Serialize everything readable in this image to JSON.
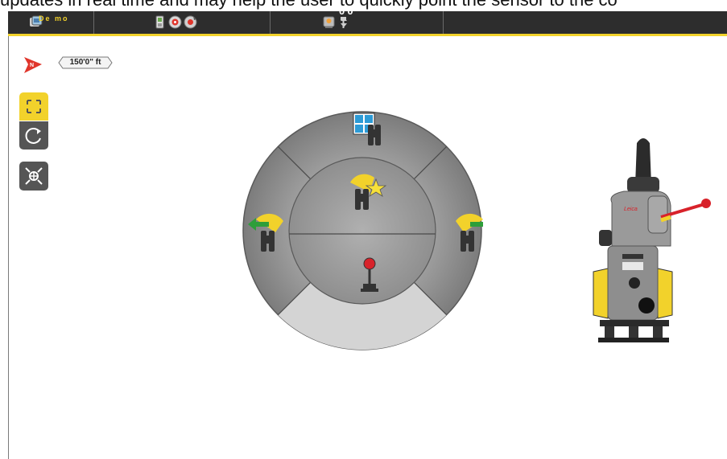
{
  "caption": "updates in real time and may help the user to quickly point the sensor to the co",
  "topbar": {
    "demo_label": "De mo",
    "angle_readout": "0'0\""
  },
  "scale": {
    "label": "150'0\" ft"
  },
  "colors": {
    "accent": "#f2d22b",
    "bar": "#2d2d2d",
    "wheel_outer": "#8c8c8c",
    "wheel_inner": "#9a9a9a",
    "wheel_highlight": "#d4d4d4",
    "north_arrow": "#e0352b",
    "arrow_green": "#2e9e3a",
    "joystick_red": "#d8222a"
  },
  "icons": {
    "topbar": [
      "demo-icon",
      "controller-icon",
      "target-icon",
      "settings-target-icon",
      "instrument-icon",
      "height-icon"
    ],
    "left": [
      "north-arrow-icon",
      "fit-to-screen-icon",
      "rotate-icon",
      "center-icon"
    ],
    "wheel": [
      "overview-camera-icon",
      "find-prism-icon",
      "turn-left-icon",
      "turn-right-icon",
      "joystick-icon"
    ]
  }
}
